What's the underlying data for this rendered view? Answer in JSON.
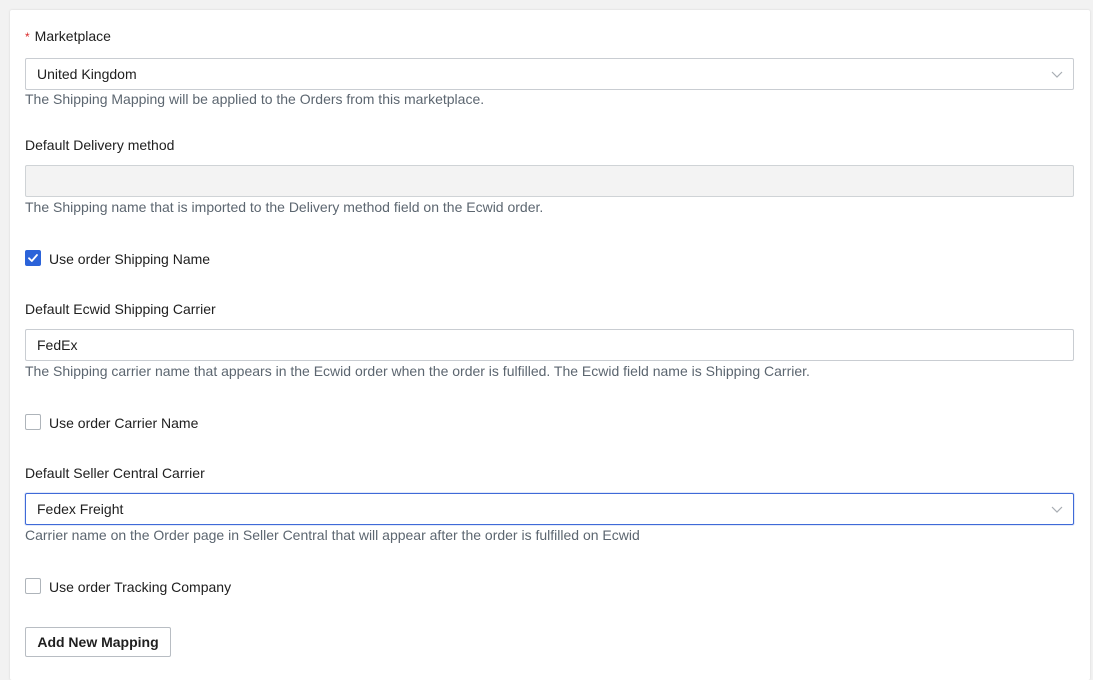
{
  "marketplace": {
    "label": "Marketplace",
    "required_mark": "*",
    "value": "United Kingdom",
    "help": "The Shipping Mapping will be applied to the Orders from this marketplace."
  },
  "default_delivery_method": {
    "label": "Default Delivery method",
    "value": "",
    "help": "The Shipping name that is imported to the Delivery method field on the Ecwid order."
  },
  "use_order_shipping_name": {
    "label": "Use order Shipping Name",
    "checked": true
  },
  "default_ecwid_carrier": {
    "label": "Default Ecwid Shipping Carrier",
    "value": "FedEx",
    "help": "The Shipping carrier name that appears in the Ecwid order when the order is fulfilled. The Ecwid field name is Shipping Carrier."
  },
  "use_order_carrier_name": {
    "label": "Use order Carrier Name",
    "checked": false
  },
  "default_seller_central_carrier": {
    "label": "Default Seller Central Carrier",
    "value": "Fedex Freight",
    "help": "Carrier name on the Order page in Seller Central that will appear after the order is fulfilled on Ecwid"
  },
  "use_order_tracking_company": {
    "label": "Use order Tracking Company",
    "checked": false
  },
  "add_button": {
    "label": "Add New Mapping"
  },
  "icons": {
    "dropdown": "chevron-down-icon",
    "checkbox": "checkmark-icon"
  },
  "colors": {
    "accent": "#2b63d9",
    "required": "#d92b2b",
    "help_text": "#5c6670",
    "focus_border": "#3f6ad8"
  }
}
